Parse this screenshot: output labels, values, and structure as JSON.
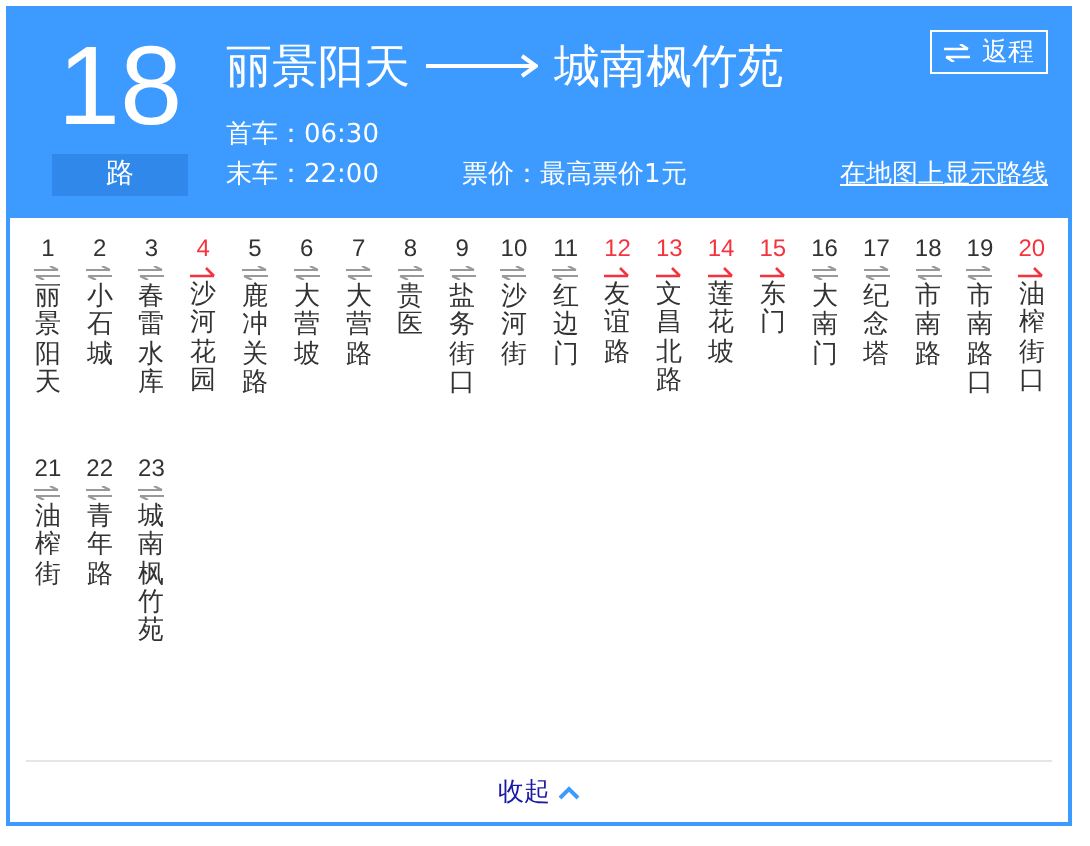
{
  "route": {
    "number": "18",
    "suffix": "路",
    "from": "丽景阳天",
    "to": "城南枫竹苑",
    "return_button": "返程",
    "first_bus": "首车：06:30",
    "last_bus": "末车：22:00",
    "fare": "票价：最高票价1元",
    "map_link": "在地图上显示路线"
  },
  "stops": [
    {
      "index": "1",
      "name": "丽景阳天",
      "kind": "both"
    },
    {
      "index": "2",
      "name": "小石城",
      "kind": "both"
    },
    {
      "index": "3",
      "name": "春雷水库",
      "kind": "both"
    },
    {
      "index": "4",
      "name": "沙河花园",
      "kind": "one_way"
    },
    {
      "index": "5",
      "name": "鹿冲关路",
      "kind": "both"
    },
    {
      "index": "6",
      "name": "大营坡",
      "kind": "both"
    },
    {
      "index": "7",
      "name": "大营路",
      "kind": "both"
    },
    {
      "index": "8",
      "name": "贵医",
      "kind": "both"
    },
    {
      "index": "9",
      "name": "盐务街口",
      "kind": "both"
    },
    {
      "index": "10",
      "name": "沙河街",
      "kind": "both"
    },
    {
      "index": "11",
      "name": "红边门",
      "kind": "both"
    },
    {
      "index": "12",
      "name": "友谊路",
      "kind": "one_way"
    },
    {
      "index": "13",
      "name": "文昌北路",
      "kind": "one_way"
    },
    {
      "index": "14",
      "name": "莲花坡",
      "kind": "one_way"
    },
    {
      "index": "15",
      "name": "东门",
      "kind": "one_way"
    },
    {
      "index": "16",
      "name": "大南门",
      "kind": "both"
    },
    {
      "index": "17",
      "name": "纪念塔",
      "kind": "both"
    },
    {
      "index": "18",
      "name": "市南路",
      "kind": "both"
    },
    {
      "index": "19",
      "name": "市南路口",
      "kind": "both"
    },
    {
      "index": "20",
      "name": "油榨街口",
      "kind": "one_way"
    },
    {
      "index": "21",
      "name": "油榨街",
      "kind": "both"
    },
    {
      "index": "22",
      "name": "青年路",
      "kind": "both"
    },
    {
      "index": "23",
      "name": "城南枫竹苑",
      "kind": "both"
    }
  ],
  "collapse_button": "收起"
}
